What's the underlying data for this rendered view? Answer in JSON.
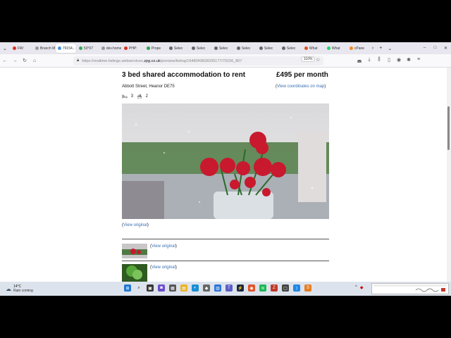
{
  "browser": {
    "tabs": [
      {
        "label": "FW: ",
        "color": "#d93025"
      },
      {
        "label": "Branch M",
        "color": "#999999"
      },
      {
        "label": "79154...",
        "color": "#4a90d9",
        "active": true
      },
      {
        "label": "53°07",
        "color": "#34a853"
      },
      {
        "label": "dev.home",
        "color": "#999999"
      },
      {
        "label": "PHP:",
        "color": "#d93025"
      },
      {
        "label": "Prope",
        "color": "#2da44e"
      },
      {
        "label": "Selec",
        "color": "#666666"
      },
      {
        "label": "Selec",
        "color": "#666666"
      },
      {
        "label": "Selec",
        "color": "#666666"
      },
      {
        "label": "Selec",
        "color": "#666666"
      },
      {
        "label": "Selec",
        "color": "#666666"
      },
      {
        "label": "Selec",
        "color": "#666666"
      },
      {
        "label": "What",
        "color": "#d9541e"
      },
      {
        "label": "What",
        "color": "#25d366"
      },
      {
        "label": "cPane",
        "color": "#f08a24"
      }
    ],
    "url_prefix": "https://realtime-listings.webservices.",
    "url_domain": "zpg.co.uk",
    "url_suffix": "/preview/listing/1648049828335177/79156_807",
    "zoom": "110%"
  },
  "listing": {
    "title": "3 bed shared accommodation to rent",
    "price": "£495 per month",
    "address": "Abbott Street, Heanor DE75",
    "coords_open": "(",
    "coords_link": "View coordinates on map",
    "coords_close": ")",
    "bedrooms": "3",
    "bathrooms": "2",
    "view_original": "View original"
  },
  "taskbar": {
    "temp": "14°C",
    "weather": "Rain coming"
  },
  "colors": {
    "link": "#3a6fb0",
    "flower": "#c8192e"
  }
}
